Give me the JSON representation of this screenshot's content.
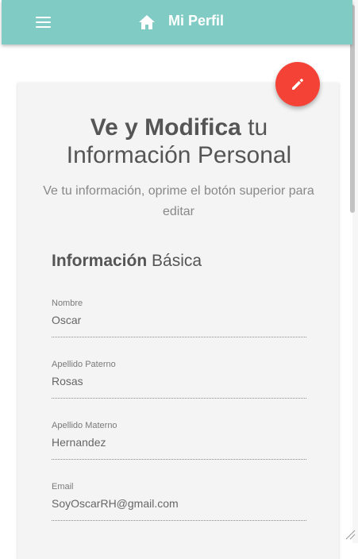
{
  "app_bar": {
    "title": "Mi Perfil",
    "menu_icon": "menu-icon",
    "home_icon": "home-icon",
    "background": "#80cbc4"
  },
  "fab": {
    "icon": "edit-icon",
    "color": "#f44336"
  },
  "card": {
    "heading_bold": "Ve y Modifica",
    "heading_rest": "tu",
    "heading_line2": "Información Personal",
    "subtitle": "Ve tu información, oprime el botón superior para editar",
    "section_bold": "Información",
    "section_rest": "Básica"
  },
  "fields": [
    {
      "label": "Nombre",
      "value": "Oscar"
    },
    {
      "label": "Apellido Paterno",
      "value": "Rosas"
    },
    {
      "label": "Apellido Materno",
      "value": "Hernandez"
    },
    {
      "label": "Email",
      "value": "SoyOscarRH@gmail.com"
    }
  ]
}
